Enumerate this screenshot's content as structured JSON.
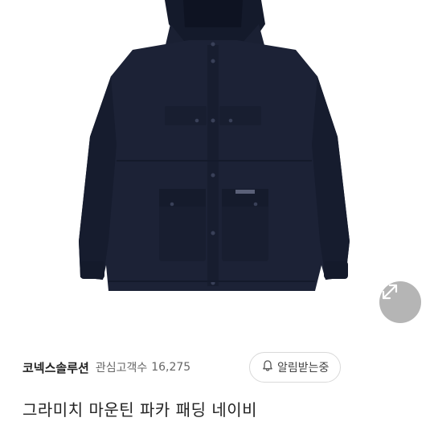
{
  "product": {
    "image_alt": "navy padded mountain parka jacket",
    "brand_tag": "grammicci",
    "title": "그라미치 마운틴 파카 패딩 네이비"
  },
  "seller": {
    "name": "코넥스솔루션",
    "follower_label": "관심고객수",
    "follower_count": "16,275"
  },
  "actions": {
    "alert_label": "알림받는중",
    "alert_icon": "bell-icon",
    "expand_icon": "expand-diagonal-icon"
  },
  "colors": {
    "jacket": "#1c2236",
    "jacket_shade": "#141a2b",
    "button_overlay": "#787878"
  }
}
